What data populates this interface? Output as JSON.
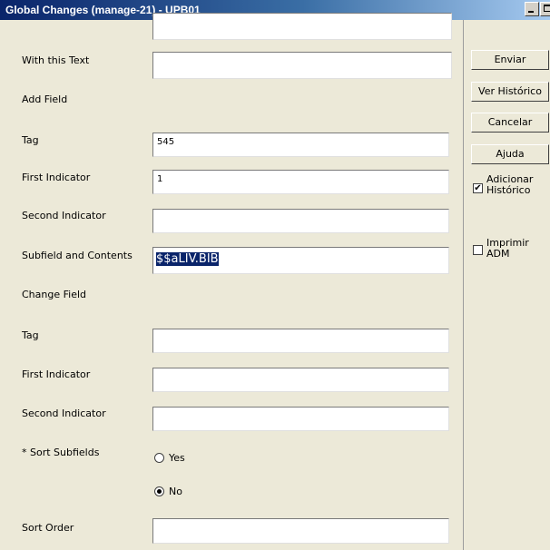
{
  "window": {
    "title": "Global Changes (manage-21) - UPB01"
  },
  "form": {
    "with_this_text": {
      "label": "With this Text",
      "value": ""
    },
    "add_field_heading": "Add Field",
    "add_tag": {
      "label": "Tag",
      "value": "545"
    },
    "add_first_indicator": {
      "label": "First Indicator",
      "value": "1"
    },
    "add_second_indicator": {
      "label": "Second Indicator",
      "value": ""
    },
    "subfield_contents": {
      "label": "Subfield and Contents",
      "value": "$$aLIV.BIB"
    },
    "change_field_heading": "Change Field",
    "change_tag": {
      "label": "Tag",
      "value": ""
    },
    "change_first_indicator": {
      "label": "First Indicator",
      "value": ""
    },
    "change_second_indicator": {
      "label": "Second Indicator",
      "value": ""
    },
    "sort_subfields": {
      "label": "* Sort Subfields",
      "options": [
        {
          "label": "Yes",
          "selected": false
        },
        {
          "label": "No",
          "selected": true
        }
      ]
    },
    "sort_order": {
      "label": "Sort Order",
      "value": ""
    }
  },
  "actions": {
    "enviar": "Enviar",
    "ver_historico": "Ver Histórico",
    "cancelar": "Cancelar",
    "ajuda": "Ajuda",
    "adicionar_historico": {
      "line1": "Adicionar",
      "line2": "Histórico",
      "checked": true
    },
    "imprimir_adm": {
      "line1": "Imprimir",
      "line2": "ADM",
      "checked": false
    }
  }
}
